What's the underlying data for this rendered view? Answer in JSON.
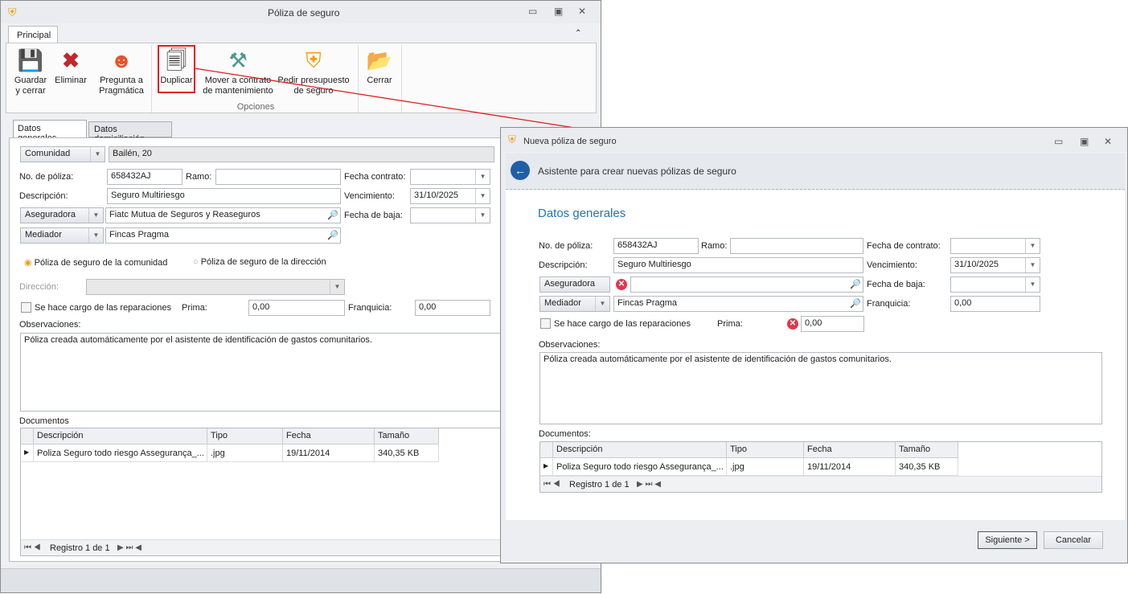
{
  "main_window": {
    "title": "Póliza de seguro",
    "ribbon_tab": "Principal",
    "ribbon": {
      "save": "Guardar\ny cerrar",
      "delete": "Eliminar",
      "ask": "Pregunta a\nPragmática",
      "duplicate": "Duplicar",
      "move": "Mover a contrato\nde mantenimiento",
      "quote": "Pedir presupuesto\nde seguro",
      "close": "Cerrar",
      "group": "Opciones"
    },
    "tabs": [
      "Datos generales",
      "Datos domiciliación"
    ],
    "form": {
      "comunidad_label": "Comunidad",
      "comunidad_value": "Bailén, 20",
      "poliza_label": "No. de póliza:",
      "poliza_value": "658432AJ",
      "ramo_label": "Ramo:",
      "ramo_value": "",
      "fecha_contrato_label": "Fecha contrato:",
      "fecha_contrato_value": "",
      "descripcion_label": "Descripción:",
      "descripcion_value": "Seguro Multiriesgo",
      "vencimiento_label": "Vencimiento:",
      "vencimiento_value": "31/10/2025",
      "aseguradora_label": "Aseguradora",
      "aseguradora_value": "Fiatc Mutua de Seguros y Reaseguros",
      "fecha_baja_label": "Fecha de baja:",
      "fecha_baja_value": "",
      "mediador_label": "Mediador",
      "mediador_value": "Fincas Pragma",
      "radio_comunidad": "Póliza de seguro de la comunidad",
      "radio_direccion": "Póliza de seguro de la dirección",
      "direccion_label": "Dirección:",
      "reparaciones_label": "Se hace cargo de las reparaciones",
      "prima_label": "Prima:",
      "prima_value": "0,00",
      "franquicia_label": "Franquicia:",
      "franquicia_value": "0,00",
      "observaciones_label": "Observaciones:",
      "observaciones_value": "Póliza creada automáticamente por el asistente de identificación de gastos comunitarios.",
      "documentos_label": "Documentos"
    },
    "grid": {
      "headers": [
        "Descripción",
        "Tipo",
        "Fecha",
        "Tamaño"
      ],
      "rows": [
        [
          "Poliza Seguro todo riesgo Assegurança_...",
          ".jpg",
          "19/11/2014",
          "340,35 KB"
        ]
      ],
      "nav": "Registro 1 de 1"
    }
  },
  "dialog": {
    "title": "Nueva póliza de seguro",
    "header": "Asistente para crear nuevas pólizas de seguro",
    "section": "Datos generales",
    "form": {
      "poliza_label": "No. de póliza:",
      "poliza_value": "658432AJ",
      "ramo_label": "Ramo:",
      "ramo_value": "",
      "fecha_contrato_label": "Fecha de contrato:",
      "fecha_contrato_value": "",
      "descripcion_label": "Descripción:",
      "descripcion_value": "Seguro Multiriesgo",
      "vencimiento_label": "Vencimiento:",
      "vencimiento_value": "31/10/2025",
      "aseguradora_label": "Aseguradora",
      "aseguradora_value": "",
      "fecha_baja_label": "Fecha de baja:",
      "fecha_baja_value": "",
      "mediador_label": "Mediador",
      "mediador_value": "Fincas Pragma",
      "franquicia_label": "Franquicia:",
      "franquicia_value": "0,00",
      "reparaciones_label": "Se hace cargo de las reparaciones",
      "prima_label": "Prima:",
      "prima_value": "0,00",
      "observaciones_label": "Observaciones:",
      "observaciones_value": "Póliza creada automáticamente por el asistente de identificación de gastos comunitarios.",
      "documentos_label": "Documentos:"
    },
    "grid": {
      "headers": [
        "Descripción",
        "Tipo",
        "Fecha",
        "Tamaño"
      ],
      "rows": [
        [
          "Poliza Seguro todo riesgo Assegurança_...",
          ".jpg",
          "19/11/2014",
          "340,35 KB"
        ]
      ],
      "nav": "Registro 1 de 1"
    },
    "next": "Siguiente >",
    "cancel": "Cancelar"
  },
  "colors": {
    "accent": "#1e73be",
    "highlight": "#e02020",
    "error": "#e0374a"
  }
}
